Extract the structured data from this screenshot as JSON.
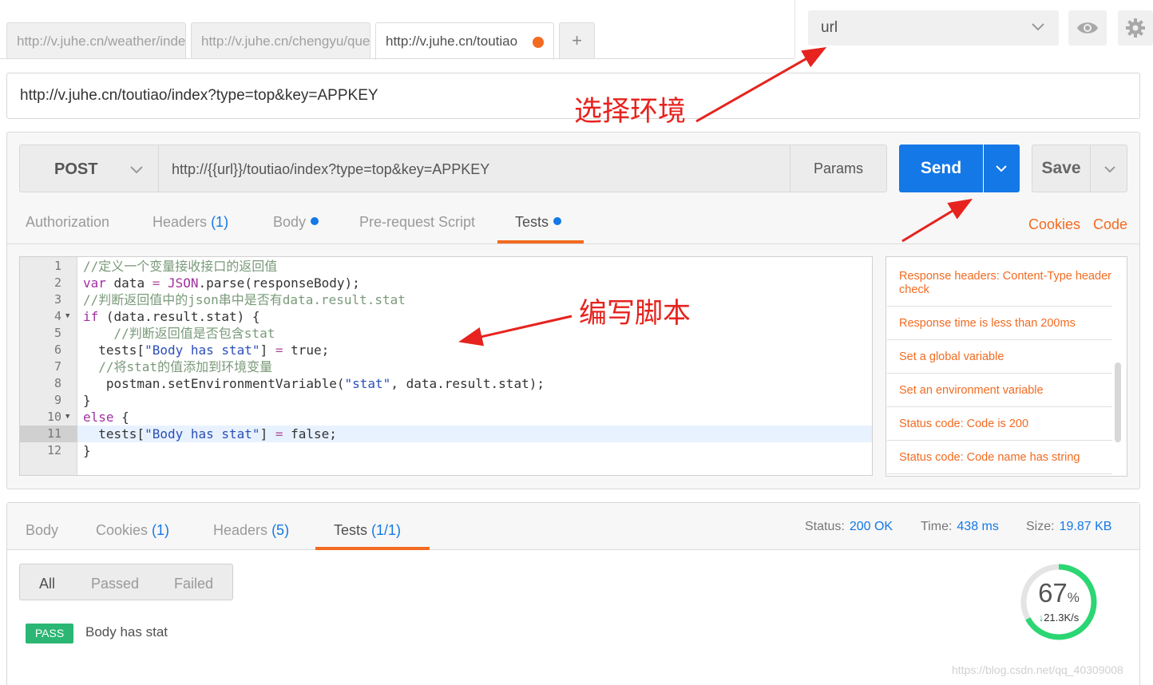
{
  "tabs": [
    {
      "label": "http://v.juhe.cn/weather/index"
    },
    {
      "label": "http://v.juhe.cn/chengyu/query"
    },
    {
      "label": "http://v.juhe.cn/toutiao"
    }
  ],
  "add_tab_label": "+",
  "environment": {
    "selected": "url"
  },
  "tab_name": "http://v.juhe.cn/toutiao/index?type=top&key=APPKEY",
  "request": {
    "method": "POST",
    "url": "http://{{url}}/toutiao/index?type=top&key=APPKEY",
    "params_label": "Params",
    "send_label": "Send",
    "save_label": "Save"
  },
  "request_tabs": {
    "authorization": "Authorization",
    "headers": "Headers",
    "headers_count": "(1)",
    "body": "Body",
    "prerequest": "Pre-request Script",
    "tests": "Tests",
    "cookies": "Cookies",
    "code": "Code"
  },
  "editor": {
    "line_numbers": [
      "1",
      "2",
      "3",
      "4",
      "5",
      "6",
      "7",
      "8",
      "9",
      "10",
      "11",
      "12"
    ],
    "lines": {
      "l1": {
        "cm": "//定义一个变量接收接口的返回值"
      },
      "l2": {
        "kw": "var",
        "a": " data ",
        "op": "=",
        "b": " ",
        "obj": "JSON",
        "c": ".parse(responseBody);"
      },
      "l3": {
        "cm": "//判断返回值中的json串中是否有data.result.stat"
      },
      "l4": {
        "kw": "if",
        "a": " (data.result.stat) {"
      },
      "l5": {
        "cm": "    //判断返回值是否包含stat"
      },
      "l6": {
        "a": "  tests[",
        "str": "\"Body has stat\"",
        "b": "] ",
        "op": "=",
        "c": " true;"
      },
      "l7": {
        "cm": "  //将stat的值添加到环境变量"
      },
      "l8": {
        "a": "   postman.setEnvironmentVariable(",
        "str1": "\"stat\"",
        "b": ", data.result.stat);"
      },
      "l9": {
        "a": "}"
      },
      "l10": {
        "kw": "else",
        "a": " {"
      },
      "l11": {
        "a": "  tests[",
        "str": "\"Body has stat\"",
        "b": "] ",
        "op": "=",
        "c": " false;"
      },
      "l12": {
        "a": "}"
      }
    }
  },
  "snippets": [
    "Response headers: Content-Type header check",
    "Response time is less than 200ms",
    "Set a global variable",
    "Set an environment variable",
    "Status code: Code is 200",
    "Status code: Code name has string"
  ],
  "response": {
    "tabs": {
      "body": "Body",
      "cookies": "Cookies",
      "cookies_count": "(1)",
      "headers": "Headers",
      "headers_count": "(5)",
      "tests": "Tests",
      "tests_count": "(1/1)"
    },
    "status_label": "Status:",
    "status_value": "200 OK",
    "time_label": "Time:",
    "time_value": "438 ms",
    "size_label": "Size:",
    "size_value": "19.87 KB",
    "filters": [
      "All",
      "Passed",
      "Failed"
    ],
    "results": [
      {
        "badge": "PASS",
        "name": "Body has stat"
      }
    ]
  },
  "gauge": {
    "percent_number": "67",
    "percent_sign": "%",
    "speed": "21.3K/s",
    "arrow": "↓",
    "fraction": 0.67
  },
  "annotations": {
    "select_env": "选择环境",
    "write_script": "编写脚本"
  },
  "watermark": "https://blog.csdn.net/qq_40309008",
  "colors": {
    "accent_blue": "#1478e6",
    "accent_orange": "#f26b21",
    "pass_green": "#2bb673",
    "annotation_red": "#e6231e"
  },
  "icons": [
    "chevron-down-icon",
    "eye-icon",
    "gear-icon",
    "arrow-down-icon"
  ]
}
